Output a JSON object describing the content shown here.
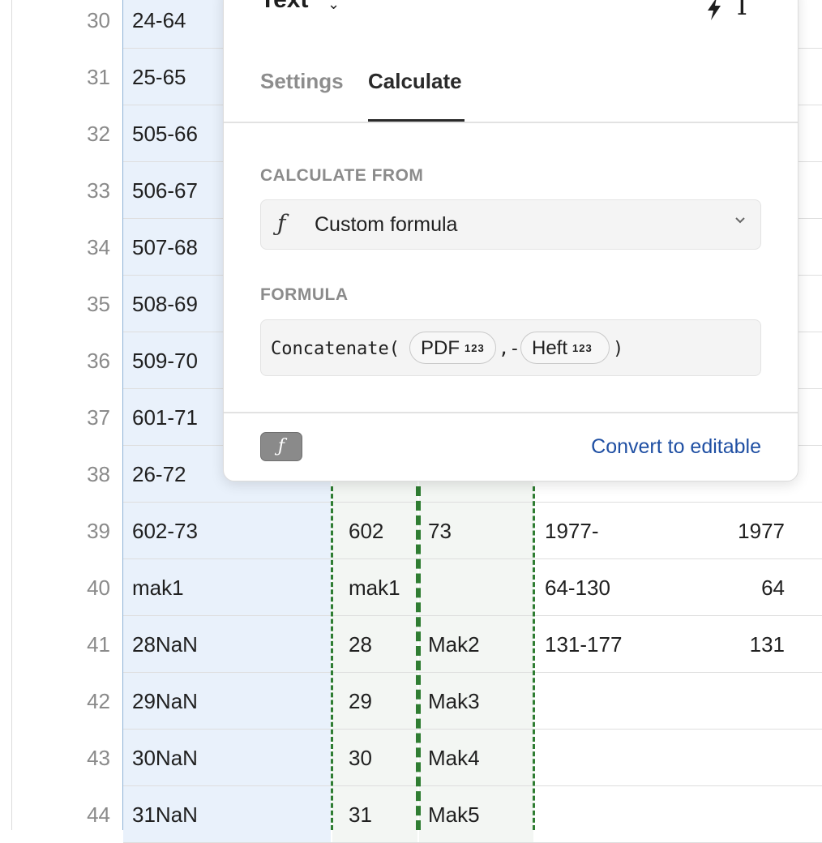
{
  "rows": [
    {
      "num": "30",
      "a": "24-64",
      "b": "",
      "c": "",
      "d": "",
      "e": ""
    },
    {
      "num": "31",
      "a": "25-65",
      "b": "",
      "c": "",
      "d": "",
      "e": ""
    },
    {
      "num": "32",
      "a": "505-66",
      "b": "",
      "c": "",
      "d": "",
      "e": ""
    },
    {
      "num": "33",
      "a": "506-67",
      "b": "",
      "c": "",
      "d": "",
      "e": ""
    },
    {
      "num": "34",
      "a": "507-68",
      "b": "",
      "c": "",
      "d": "",
      "e": ""
    },
    {
      "num": "35",
      "a": "508-69",
      "b": "",
      "c": "",
      "d": "",
      "e": ""
    },
    {
      "num": "36",
      "a": "509-70",
      "b": "",
      "c": "",
      "d": "",
      "e": ""
    },
    {
      "num": "37",
      "a": "601-71",
      "b": "",
      "c": "",
      "d": "",
      "e": ""
    },
    {
      "num": "38",
      "a": "26-72",
      "b": "",
      "c": "",
      "d": "",
      "e": ""
    },
    {
      "num": "39",
      "a": "602-73",
      "b": "602",
      "c": "73",
      "d": "1977-",
      "e": "1977"
    },
    {
      "num": "40",
      "a": "mak1",
      "b": "mak1",
      "c": "",
      "d": "64-130",
      "e": "64"
    },
    {
      "num": "41",
      "a": "28NaN",
      "b": "28",
      "c": "Mak2",
      "d": "131-177",
      "e": "131"
    },
    {
      "num": "42",
      "a": "29NaN",
      "b": "29",
      "c": "Mak3",
      "d": "",
      "e": ""
    },
    {
      "num": "43",
      "a": "30NaN",
      "b": "30",
      "c": "Mak4",
      "d": "",
      "e": ""
    },
    {
      "num": "44",
      "a": "31NaN",
      "b": "31",
      "c": "Mak5",
      "d": "",
      "e": ""
    }
  ],
  "popover": {
    "title": "Text",
    "tabs": {
      "settings": "Settings",
      "calculate": "Calculate"
    },
    "calculate_from_label": "CALCULATE FROM",
    "calculate_from_value": "Custom formula",
    "formula_label": "FORMULA",
    "formula": {
      "func_open": "Concatenate(",
      "chip1": "PDF",
      "chip1_type": "123",
      "separator": ",-",
      "chip2": "Heft",
      "chip2_type": "123",
      "close": ")"
    },
    "fx_badge": "ƒ",
    "convert_link": "Convert to editable"
  },
  "icons": {
    "title_chevron": "chevron-down-icon",
    "bolt": "bolt-icon",
    "text_type": "text-type-icon",
    "function": "function-icon",
    "select_chevron": "chevron-down-icon"
  }
}
